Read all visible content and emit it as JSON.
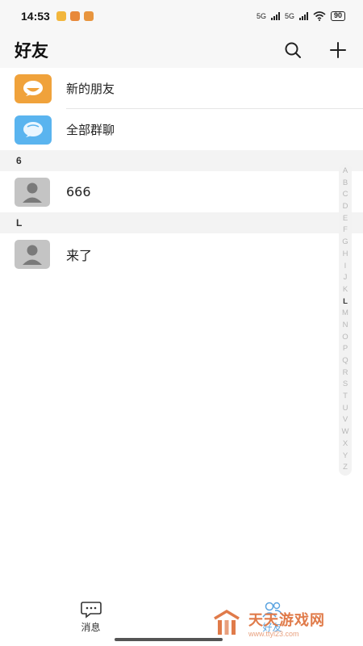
{
  "status": {
    "time": "14:53",
    "net1": "5G",
    "net2": "5G",
    "battery": "90"
  },
  "header": {
    "title": "好友"
  },
  "special_items": [
    {
      "label": "新的朋友",
      "color": "#f0a23b"
    },
    {
      "label": "全部群聊",
      "color": "#5ab4ef"
    }
  ],
  "sections": [
    {
      "letter": "6",
      "contacts": [
        {
          "name": "666"
        }
      ]
    },
    {
      "letter": "L",
      "contacts": [
        {
          "name": "来了"
        }
      ]
    }
  ],
  "index_letters": [
    "A",
    "B",
    "C",
    "D",
    "E",
    "F",
    "G",
    "H",
    "I",
    "J",
    "K",
    "L",
    "M",
    "N",
    "O",
    "P",
    "Q",
    "R",
    "S",
    "T",
    "U",
    "V",
    "W",
    "X",
    "Y",
    "Z"
  ],
  "index_active": "L",
  "tabs": [
    {
      "label": "消息",
      "icon": "chat-icon",
      "active": false
    },
    {
      "label": "好友",
      "icon": "friends-icon",
      "active": true
    }
  ],
  "watermark": {
    "title": "天天游戏网",
    "url": "www.ttyl23.com"
  },
  "colors": {
    "accent": "#5aa3e0",
    "orange": "#f0a23b",
    "blue": "#5ab4ef"
  }
}
